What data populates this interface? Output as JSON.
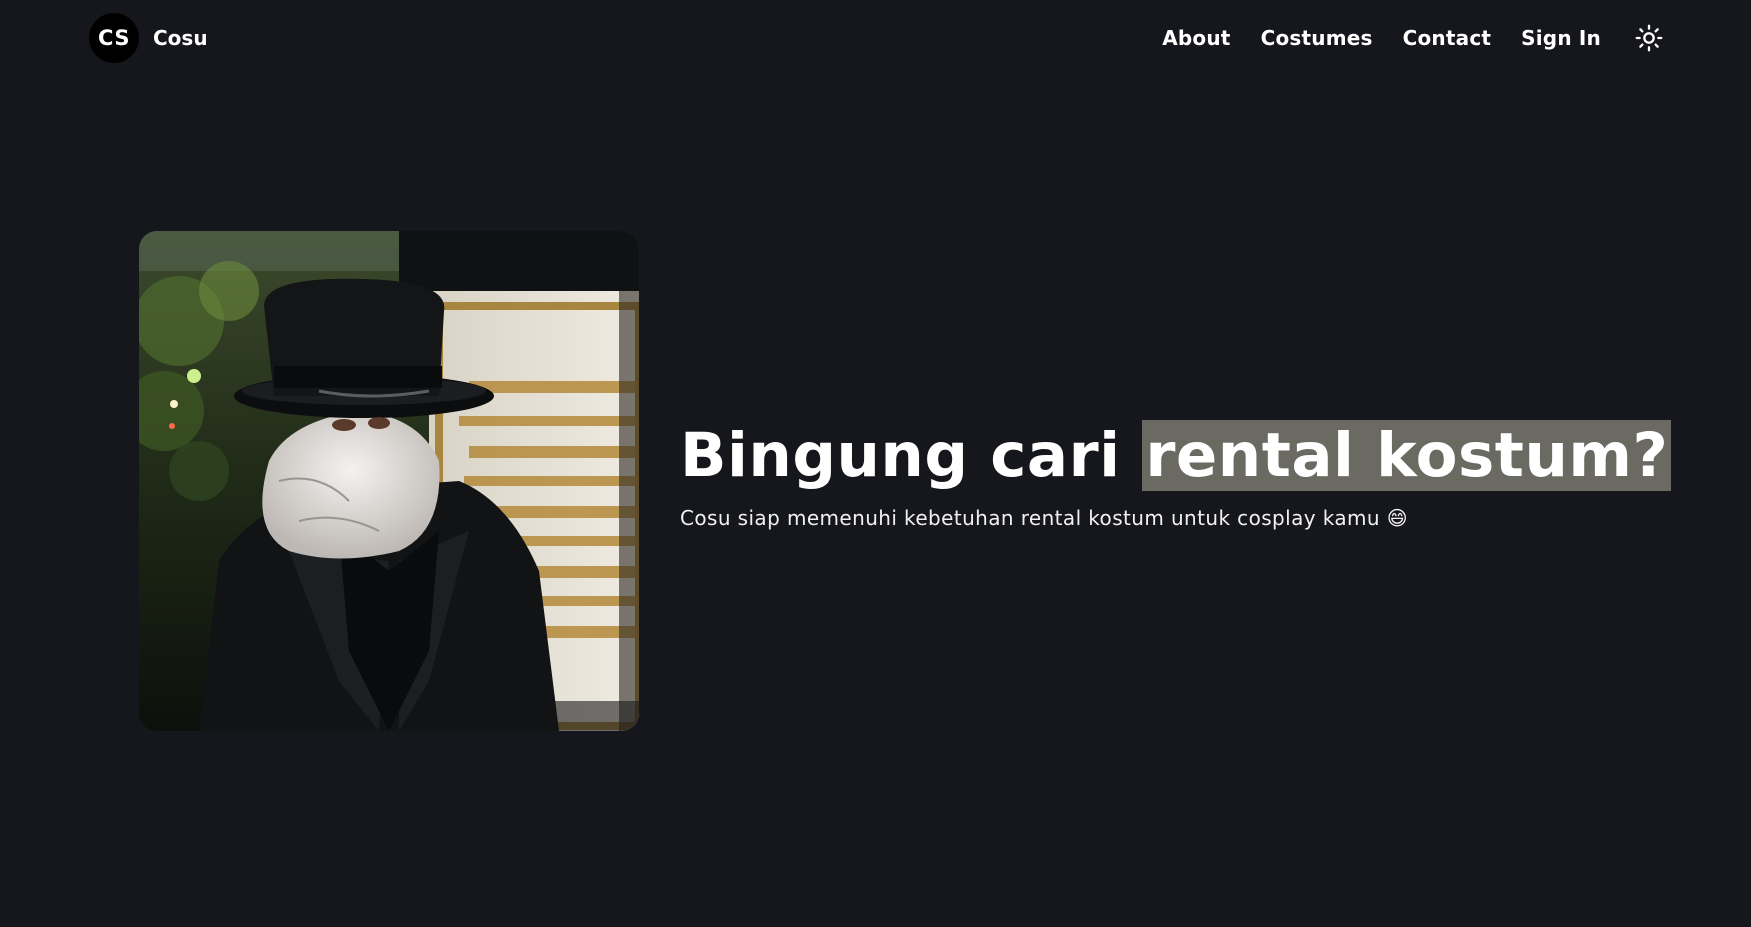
{
  "brand": {
    "logo_text": "CS",
    "name": "Cosu"
  },
  "nav": {
    "about": "About",
    "costumes": "Costumes",
    "contact": "Contact",
    "sign_in": "Sign In",
    "theme_icon": "sun-icon"
  },
  "hero": {
    "title_plain": "Bingung cari ",
    "title_highlight": "rental kostum?",
    "subtitle": "Cosu siap memenuhi kebetuhan rental kostum untuk cosplay kamu 😄",
    "image_subject": "costumed figure in black top hat and coat with bandaged face"
  },
  "colors": {
    "background": "#16171c",
    "text": "#ffffff",
    "highlight": "#6b6a62",
    "logo_bg": "#000000"
  }
}
